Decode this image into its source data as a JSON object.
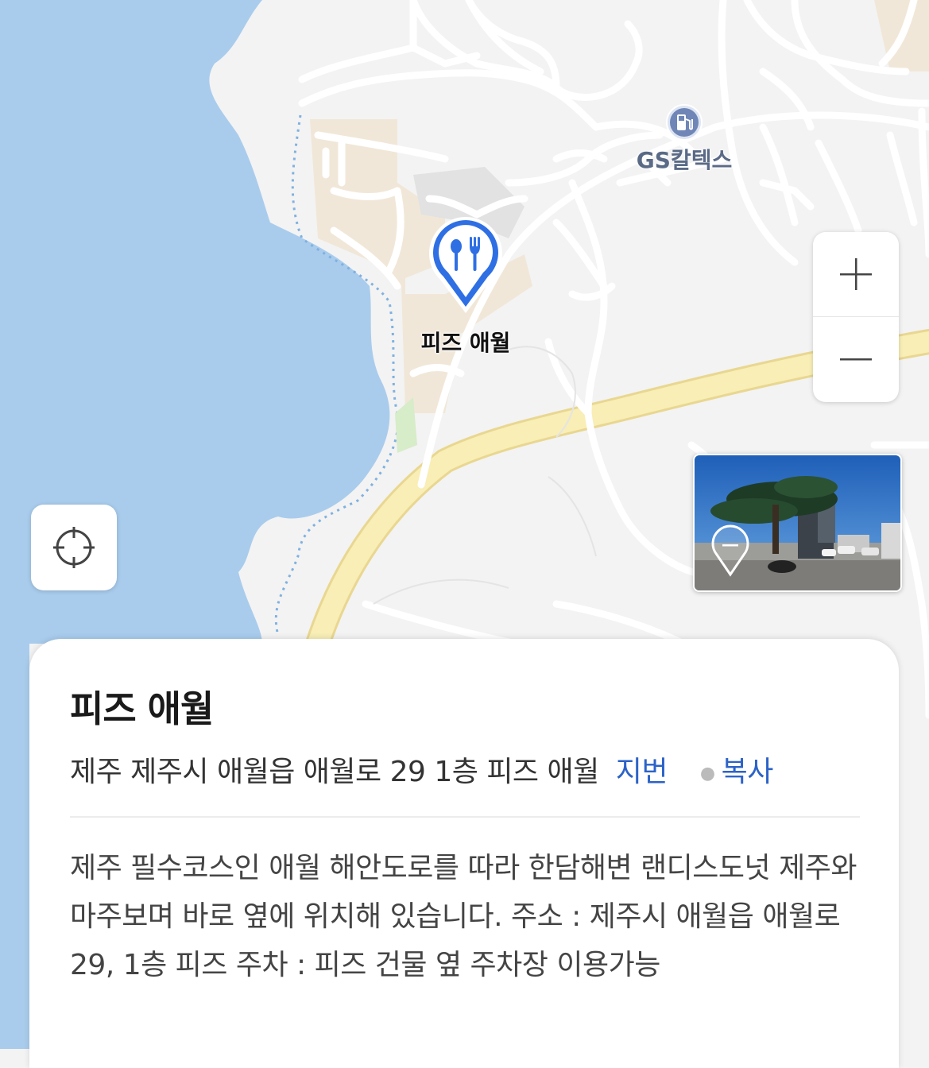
{
  "map": {
    "poi_name": "피즈 애월",
    "landmark_label": "GS칼텍스"
  },
  "controls": {
    "zoom_in_icon": "plus-icon",
    "zoom_out_icon": "minus-icon",
    "locate_icon": "crosshair-icon"
  },
  "place": {
    "title": "피즈 애월",
    "address": "제주 제주시 애월읍 애월로 29 1층 피즈 애월",
    "jibun_link": "지번",
    "copy_link": "복사",
    "description": "제주 필수코스인 애월 해안도로를 따라 한담해변 랜디스도넛 제주와 마주보며 바로 옆에 위치해 있습니다. 주소 : 제주시 애월읍 애월로29, 1층 피즈 주차 : 피즈 건물 옆 주차장 이용가능"
  },
  "colors": {
    "sea": "#a9cced",
    "land": "#f3f3f3",
    "road": "#ffffff",
    "highway": "#f6e6a0",
    "accent_blue": "#2c63c8",
    "poi_blue": "#2f6fe4"
  }
}
